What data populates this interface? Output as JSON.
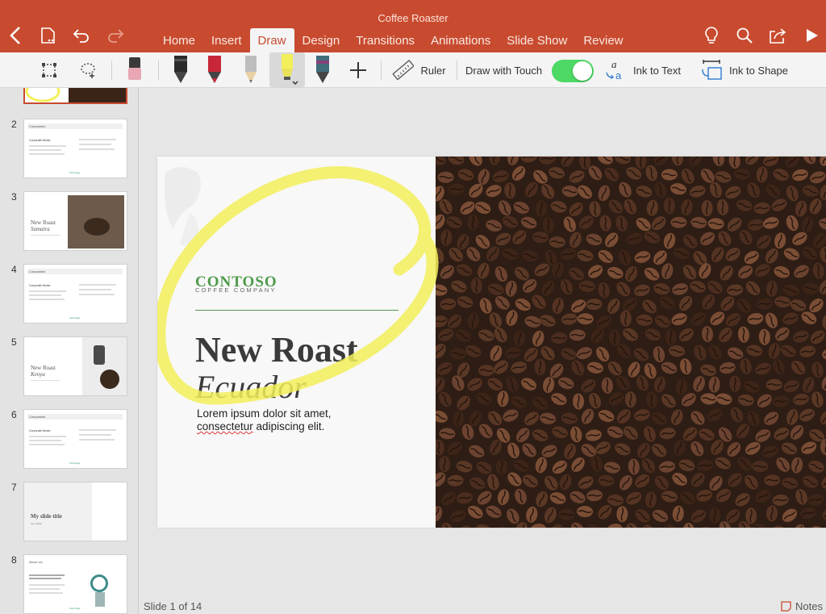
{
  "app": {
    "doc_title": "Coffee Roaster"
  },
  "ribbon_tabs": [
    {
      "label": "Home"
    },
    {
      "label": "Insert"
    },
    {
      "label": "Draw"
    },
    {
      "label": "Design"
    },
    {
      "label": "Transitions"
    },
    {
      "label": "Animations"
    },
    {
      "label": "Slide Show"
    },
    {
      "label": "Review"
    }
  ],
  "active_tab": "Draw",
  "toolbar": {
    "ruler_label": "Ruler",
    "draw_with_touch_label": "Draw with Touch",
    "draw_with_touch_on": true,
    "ink_to_text_label": "Ink to Text",
    "ink_to_shape_label": "Ink to Shape",
    "pens": [
      {
        "name": "eraser",
        "color": "#e8a7b3"
      },
      {
        "name": "pen-black",
        "color": "#2b2b2b"
      },
      {
        "name": "pen-red",
        "color": "#c8273a"
      },
      {
        "name": "pencil-gray",
        "color": "#9a9a9a"
      },
      {
        "name": "highlighter-yellow",
        "color": "#f3ef5b",
        "selected": true
      },
      {
        "name": "pen-galaxy",
        "color": "#3f6d7a"
      }
    ]
  },
  "thumbnails": [
    {
      "num": "2",
      "title": "Companies",
      "kind": "text",
      "heading": "Corporate Works",
      "link": "Visit Page"
    },
    {
      "num": "3",
      "kind": "photo",
      "line1": "New Roast",
      "line2": "Sumatra"
    },
    {
      "num": "4",
      "title": "Companies",
      "kind": "text",
      "heading": "Corporate Works",
      "link": "Visit Page"
    },
    {
      "num": "5",
      "kind": "photo",
      "line1": "New Roast",
      "line2": "Kenya"
    },
    {
      "num": "6",
      "title": "Companies",
      "kind": "text",
      "heading": "Corporate Works",
      "link": "Visit Page"
    },
    {
      "num": "7",
      "kind": "title",
      "line1": "My slide title",
      "line2": "My subtitle"
    },
    {
      "num": "8",
      "title": "About Us",
      "kind": "about",
      "link": "Visit Page"
    }
  ],
  "slide": {
    "brand": "CONTOSO",
    "brand_sub": "COFFEE COMPANY",
    "title_line1": "New Roast",
    "title_line2": "Ecuador",
    "body_part1": "Lorem ipsum dolor sit amet,",
    "body_squiggle": "consectetur",
    "body_part2": " adipiscing elit."
  },
  "colors": {
    "accent": "#c84b2f",
    "brand_green": "#4d9a4a",
    "ink_yellow": "#f3ef5b",
    "toggle_green": "#4cd964"
  },
  "status": {
    "slide_count": "Slide 1 of 14",
    "notes_label": "Notes"
  }
}
